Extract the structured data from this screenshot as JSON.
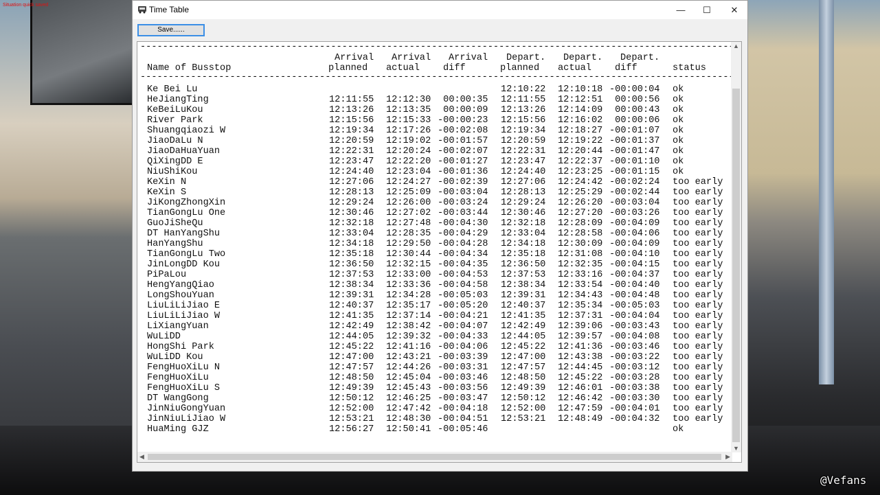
{
  "game": {
    "message": "Situation quick saved",
    "watermark": "@Vefans"
  },
  "window": {
    "title": "Time Table",
    "minimize": "—",
    "maximize": "☐",
    "close": "✕",
    "save_label": "Save......"
  },
  "table": {
    "header_top": {
      "arr_planned": "Arrival",
      "arr_actual": "Arrival",
      "arr_diff": "Arrival",
      "dep_planned": "Depart.",
      "dep_actual": "Depart.",
      "dep_diff": "Depart."
    },
    "header_bottom": {
      "name": "Name of Busstop",
      "arr_planned": "planned",
      "arr_actual": "actual",
      "arr_diff": "diff",
      "dep_planned": "planned",
      "dep_actual": "actual",
      "dep_diff": "diff",
      "status": "status"
    },
    "rows": [
      [
        "Ke Bei Lu",
        "",
        "",
        "",
        "12:10:22",
        "12:10:18",
        "-00:00:04",
        "ok"
      ],
      [
        "HeJiangTing",
        "12:11:55",
        "12:12:30",
        " 00:00:35",
        "12:11:55",
        "12:12:51",
        " 00:00:56",
        "ok"
      ],
      [
        "KeBeiLuKou",
        "12:13:26",
        "12:13:35",
        " 00:00:09",
        "12:13:26",
        "12:14:09",
        " 00:00:43",
        "ok"
      ],
      [
        "River Park",
        "12:15:56",
        "12:15:33",
        "-00:00:23",
        "12:15:56",
        "12:16:02",
        " 00:00:06",
        "ok"
      ],
      [
        "Shuangqiaozi W",
        "12:19:34",
        "12:17:26",
        "-00:02:08",
        "12:19:34",
        "12:18:27",
        "-00:01:07",
        "ok"
      ],
      [
        "JiaoDaLu N",
        "12:20:59",
        "12:19:02",
        "-00:01:57",
        "12:20:59",
        "12:19:22",
        "-00:01:37",
        "ok"
      ],
      [
        "JiaoDaHuaYuan",
        "12:22:31",
        "12:20:24",
        "-00:02:07",
        "12:22:31",
        "12:20:44",
        "-00:01:47",
        "ok"
      ],
      [
        "QiXingDD E",
        "12:23:47",
        "12:22:20",
        "-00:01:27",
        "12:23:47",
        "12:22:37",
        "-00:01:10",
        "ok"
      ],
      [
        "NiuShiKou",
        "12:24:40",
        "12:23:04",
        "-00:01:36",
        "12:24:40",
        "12:23:25",
        "-00:01:15",
        "ok"
      ],
      [
        "KeXin N",
        "12:27:06",
        "12:24:27",
        "-00:02:39",
        "12:27:06",
        "12:24:42",
        "-00:02:24",
        "too early"
      ],
      [
        "KeXin S",
        "12:28:13",
        "12:25:09",
        "-00:03:04",
        "12:28:13",
        "12:25:29",
        "-00:02:44",
        "too early"
      ],
      [
        "JiKongZhongXin",
        "12:29:24",
        "12:26:00",
        "-00:03:24",
        "12:29:24",
        "12:26:20",
        "-00:03:04",
        "too early"
      ],
      [
        "TianGongLu One",
        "12:30:46",
        "12:27:02",
        "-00:03:44",
        "12:30:46",
        "12:27:20",
        "-00:03:26",
        "too early"
      ],
      [
        "GuoJiSheQu",
        "12:32:18",
        "12:27:48",
        "-00:04:30",
        "12:32:18",
        "12:28:09",
        "-00:04:09",
        "too early"
      ],
      [
        "DT HanYangShu",
        "12:33:04",
        "12:28:35",
        "-00:04:29",
        "12:33:04",
        "12:28:58",
        "-00:04:06",
        "too early"
      ],
      [
        "HanYangShu",
        "12:34:18",
        "12:29:50",
        "-00:04:28",
        "12:34:18",
        "12:30:09",
        "-00:04:09",
        "too early"
      ],
      [
        "TianGongLu Two",
        "12:35:18",
        "12:30:44",
        "-00:04:34",
        "12:35:18",
        "12:31:08",
        "-00:04:10",
        "too early"
      ],
      [
        "JinLongDD Kou",
        "12:36:50",
        "12:32:15",
        "-00:04:35",
        "12:36:50",
        "12:32:35",
        "-00:04:15",
        "too early"
      ],
      [
        "PiPaLou",
        "12:37:53",
        "12:33:00",
        "-00:04:53",
        "12:37:53",
        "12:33:16",
        "-00:04:37",
        "too early"
      ],
      [
        "HengYangQiao",
        "12:38:34",
        "12:33:36",
        "-00:04:58",
        "12:38:34",
        "12:33:54",
        "-00:04:40",
        "too early"
      ],
      [
        "LongShouYuan",
        "12:39:31",
        "12:34:28",
        "-00:05:03",
        "12:39:31",
        "12:34:43",
        "-00:04:48",
        "too early"
      ],
      [
        "LiuLiLiJiao E",
        "12:40:37",
        "12:35:17",
        "-00:05:20",
        "12:40:37",
        "12:35:34",
        "-00:05:03",
        "too early"
      ],
      [
        "LiuLiLiJiao W",
        "12:41:35",
        "12:37:14",
        "-00:04:21",
        "12:41:35",
        "12:37:31",
        "-00:04:04",
        "too early"
      ],
      [
        "LiXiangYuan",
        "12:42:49",
        "12:38:42",
        "-00:04:07",
        "12:42:49",
        "12:39:06",
        "-00:03:43",
        "too early"
      ],
      [
        "WuLiDD",
        "12:44:05",
        "12:39:32",
        "-00:04:33",
        "12:44:05",
        "12:39:57",
        "-00:04:08",
        "too early"
      ],
      [
        "HongShi Park",
        "12:45:22",
        "12:41:16",
        "-00:04:06",
        "12:45:22",
        "12:41:36",
        "-00:03:46",
        "too early"
      ],
      [
        "WuLiDD Kou",
        "12:47:00",
        "12:43:21",
        "-00:03:39",
        "12:47:00",
        "12:43:38",
        "-00:03:22",
        "too early"
      ],
      [
        "FengHuoXiLu N",
        "12:47:57",
        "12:44:26",
        "-00:03:31",
        "12:47:57",
        "12:44:45",
        "-00:03:12",
        "too early"
      ],
      [
        "FengHuoXiLu",
        "12:48:50",
        "12:45:04",
        "-00:03:46",
        "12:48:50",
        "12:45:22",
        "-00:03:28",
        "too early"
      ],
      [
        "FengHuoXiLu S",
        "12:49:39",
        "12:45:43",
        "-00:03:56",
        "12:49:39",
        "12:46:01",
        "-00:03:38",
        "too early"
      ],
      [
        "DT WangGong",
        "12:50:12",
        "12:46:25",
        "-00:03:47",
        "12:50:12",
        "12:46:42",
        "-00:03:30",
        "too early"
      ],
      [
        "JinNiuGongYuan",
        "12:52:00",
        "12:47:42",
        "-00:04:18",
        "12:52:00",
        "12:47:59",
        "-00:04:01",
        "too early"
      ],
      [
        "JinNiuLiJiao W",
        "12:53:21",
        "12:48:30",
        "-00:04:51",
        "12:53:21",
        "12:48:49",
        "-00:04:32",
        "too early"
      ],
      [
        "HuaMing GJZ",
        "12:56:27",
        "12:50:41",
        "-00:05:46",
        "",
        "",
        "",
        "ok"
      ]
    ]
  }
}
